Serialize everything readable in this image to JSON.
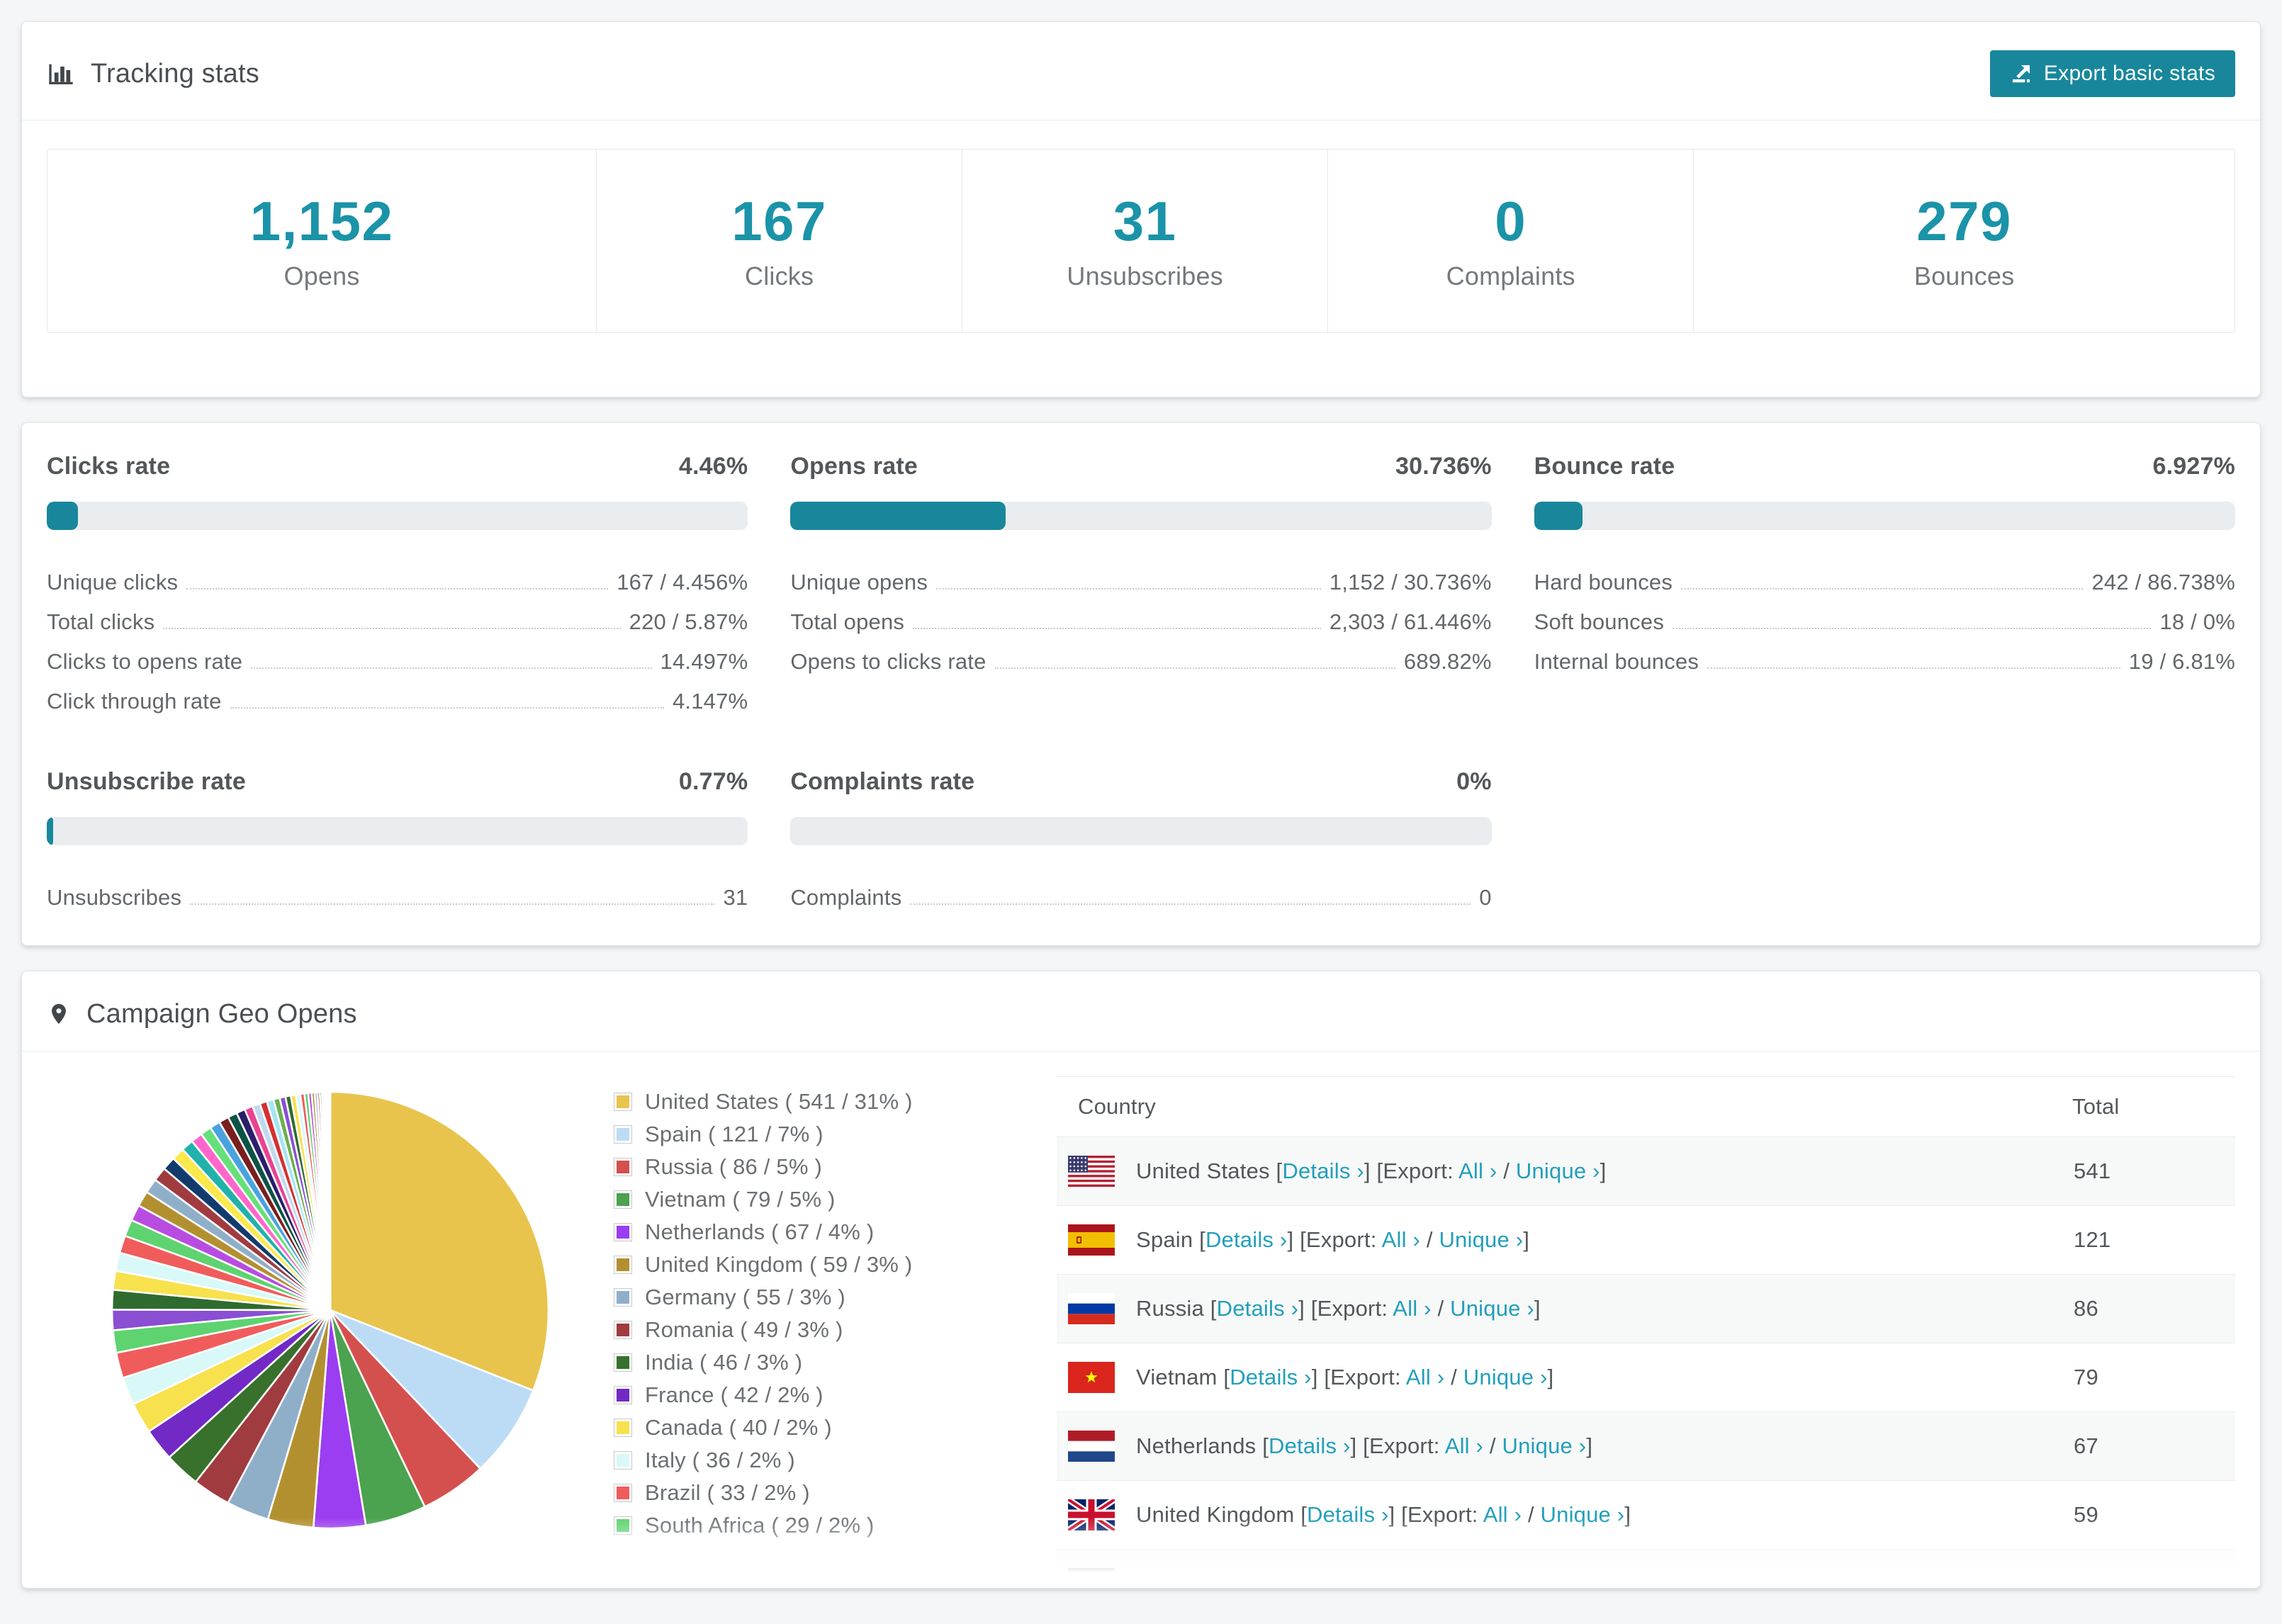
{
  "theme": {
    "accent": "#1b93a8",
    "accent_dark": "#18879b",
    "link": "#229fbb",
    "track": "#e9edf0",
    "page_bg": "#f5f6f7",
    "card_bg": "#ffffff"
  },
  "tracking": {
    "title": "Tracking stats",
    "export_button": "Export basic stats",
    "stats": [
      {
        "value": "1,152",
        "label": "Opens"
      },
      {
        "value": "167",
        "label": "Clicks"
      },
      {
        "value": "31",
        "label": "Unsubscribes"
      },
      {
        "value": "0",
        "label": "Complaints"
      },
      {
        "value": "279",
        "label": "Bounces"
      }
    ]
  },
  "rates": {
    "panels": [
      {
        "title": "Clicks rate",
        "value": "4.46%",
        "percent": 4.46,
        "rows": [
          {
            "label": "Unique clicks",
            "value": "167 / 4.456%"
          },
          {
            "label": "Total clicks",
            "value": "220 / 5.87%"
          },
          {
            "label": "Clicks to opens rate",
            "value": "14.497%"
          },
          {
            "label": "Click through rate",
            "value": "4.147%"
          }
        ]
      },
      {
        "title": "Opens rate",
        "value": "30.736%",
        "percent": 30.736,
        "rows": [
          {
            "label": "Unique opens",
            "value": "1,152 / 30.736%"
          },
          {
            "label": "Total opens",
            "value": "2,303 / 61.446%"
          },
          {
            "label": "Opens to clicks rate",
            "value": "689.82%"
          }
        ]
      },
      {
        "title": "Bounce rate",
        "value": "6.927%",
        "percent": 6.927,
        "rows": [
          {
            "label": "Hard bounces",
            "value": "242 / 86.738%"
          },
          {
            "label": "Soft bounces",
            "value": "18 / 0%"
          },
          {
            "label": "Internal bounces",
            "value": "19 / 6.81%"
          }
        ]
      },
      {
        "title": "Unsubscribe rate",
        "value": "0.77%",
        "percent": 0.77,
        "rows": [
          {
            "label": "Unsubscribes",
            "value": "31"
          }
        ]
      },
      {
        "title": "Complaints rate",
        "value": "0%",
        "percent": 0,
        "rows": [
          {
            "label": "Complaints",
            "value": "0"
          }
        ]
      }
    ]
  },
  "geo": {
    "title": "Campaign Geo Opens",
    "table": {
      "headers": [
        "Country",
        "Total"
      ],
      "details_label": "Details",
      "export_label": "Export:",
      "all_label": "All",
      "unique_label": "Unique",
      "chevron": "›",
      "visible_rows": 7
    }
  },
  "chart_data": {
    "type": "pie",
    "title": "Campaign Geo Opens",
    "labels": [
      "United States",
      "Spain",
      "Russia",
      "Vietnam",
      "Netherlands",
      "United Kingdom",
      "Germany",
      "Romania",
      "India",
      "France",
      "Canada",
      "Italy",
      "Brazil",
      "South Africa"
    ],
    "values": [
      541,
      121,
      86,
      79,
      67,
      59,
      55,
      49,
      46,
      42,
      40,
      36,
      33,
      29
    ],
    "percent_labels": [
      "31%",
      "7%",
      "5%",
      "5%",
      "4%",
      "3%",
      "3%",
      "3%",
      "3%",
      "2%",
      "2%",
      "2%",
      "2%",
      "2%"
    ],
    "colors": [
      "#E8C44C",
      "#BCDCF5",
      "#D4504E",
      "#4BA24F",
      "#9B3DF0",
      "#B3902F",
      "#8FAFC9",
      "#A03B40",
      "#37712C",
      "#7229C5",
      "#F7E14D",
      "#D9F8F8",
      "#F05C5C",
      "#5ED370"
    ],
    "flags": [
      "us",
      "es",
      "ru",
      "vn",
      "nl",
      "gb",
      "de",
      "ro",
      "in",
      "fr",
      "ca",
      "it",
      "br",
      "za"
    ],
    "others_total": 462,
    "others_count": 46,
    "tail_palette": [
      "#8A4FD3",
      "#2F6B2F",
      "#F7E14D",
      "#D9F8F8",
      "#F05C5C",
      "#5ED370",
      "#B94CE0",
      "#B3902F",
      "#8FAFC9",
      "#A03B40",
      "#123B6D",
      "#F9E94A",
      "#20B2AA",
      "#FF66CC",
      "#66E07A",
      "#4AA3DF",
      "#7B1E1E",
      "#0B5345",
      "#2C1E6B",
      "#E84393",
      "#C0D9EE",
      "#D63031",
      "#A2E5F2",
      "#6AB04C"
    ],
    "legend_position": "right",
    "start_angle_deg": -90,
    "direction": "clockwise",
    "legend_format": "{label} ( {value} / {percent} )"
  }
}
